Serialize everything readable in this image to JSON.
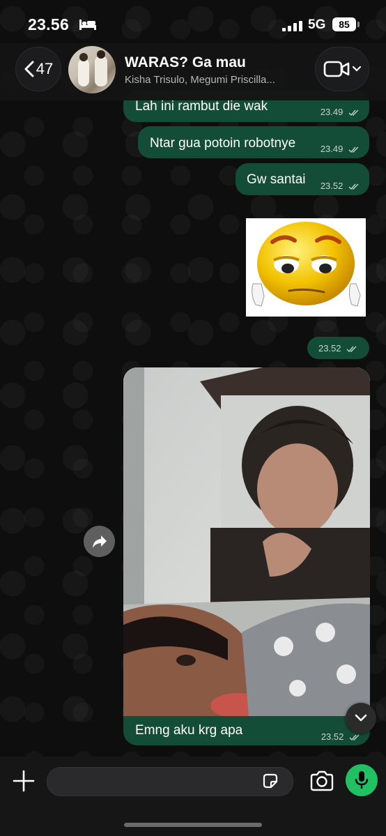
{
  "status_bar": {
    "time": "23.56",
    "network": "5G",
    "battery": "85"
  },
  "header": {
    "back_count": "47",
    "title": "WARAS? Ga mau",
    "members": "Kisha Trisulo, Megumi Priscilla..."
  },
  "messages": [
    {
      "text": "Lah ini rambut die wak",
      "time": "23.49"
    },
    {
      "text": "Ntar gua potoin robotnye",
      "time": "23.49"
    },
    {
      "text": "Gw santai",
      "time": "23.52"
    },
    {
      "type": "sticker",
      "time": "23.52"
    },
    {
      "type": "photo",
      "caption": "Emng aku krg apa",
      "time": "23.52"
    }
  ],
  "colors": {
    "outgoing_bubble": "#144d37",
    "mic_button": "#21c063",
    "background": "#0b0b0b"
  },
  "icons": [
    "bed-icon",
    "signal-icon",
    "back-chevron-icon",
    "video-camera-icon",
    "forward-icon",
    "scroll-down-icon",
    "plus-icon",
    "sticker-icon",
    "camera-icon",
    "mic-icon",
    "double-check-icon"
  ]
}
